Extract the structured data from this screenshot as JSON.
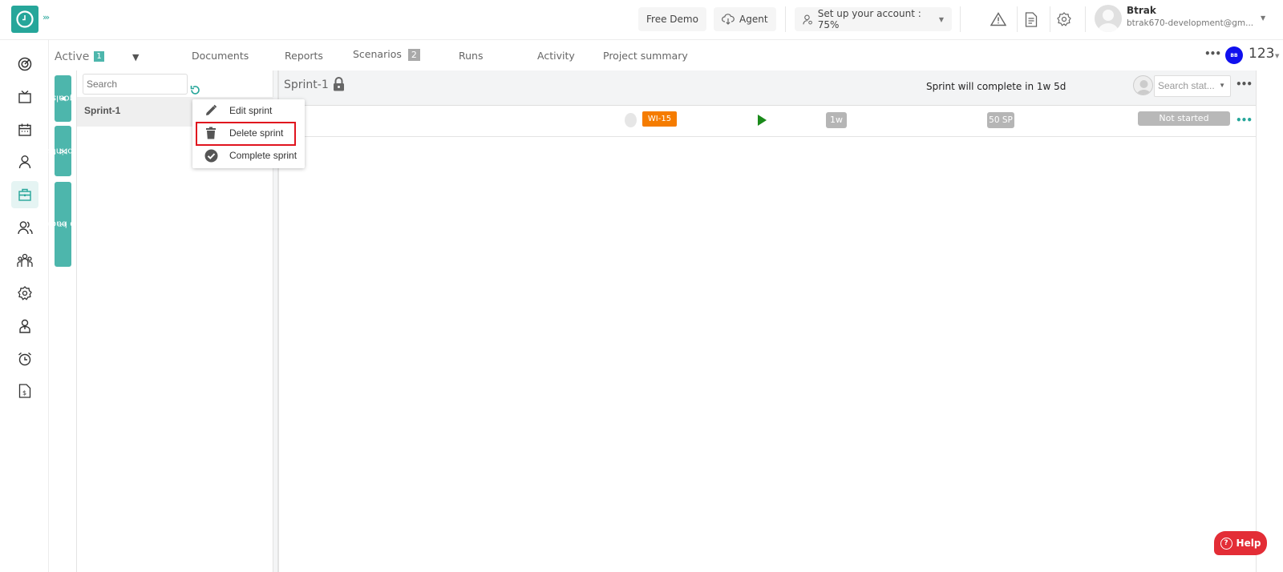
{
  "topbar": {
    "expand_icon": "chevrons-right",
    "free_demo_label": "Free Demo",
    "agent_label": "Agent",
    "setup_label": "Set up your account : 75%",
    "setup_progress_percent": 75,
    "user_name": "Btrak",
    "user_email": "btrak670-development@gm..."
  },
  "left_nav": {
    "items": [
      {
        "icon": "target-icon"
      },
      {
        "icon": "tv-icon"
      },
      {
        "icon": "calendar-icon"
      },
      {
        "icon": "user-icon"
      },
      {
        "icon": "briefcase-icon",
        "active": true
      },
      {
        "icon": "users-icon"
      },
      {
        "icon": "team-icon"
      },
      {
        "icon": "settings-icon"
      },
      {
        "icon": "user-profile-icon"
      },
      {
        "icon": "alarm-icon"
      },
      {
        "icon": "invoice-icon"
      }
    ]
  },
  "tabs": {
    "active_label": "Active",
    "active_count": "1",
    "items": [
      {
        "label": "Documents"
      },
      {
        "label": "Reports"
      },
      {
        "label": "Scenarios",
        "badge": "2"
      },
      {
        "label": "Runs"
      },
      {
        "label": "Activity"
      },
      {
        "label": "Project summary"
      }
    ]
  },
  "project": {
    "avatar_initials": "BB",
    "avatar_color": "#1010ee",
    "name": "123"
  },
  "side_pills": {
    "goals": "goals",
    "sprints": "Sprints",
    "backlog": "Go to backlog"
  },
  "sprint_list": {
    "search_placeholder": "Search",
    "items": [
      {
        "name": "Sprint-1"
      }
    ]
  },
  "context_menu": {
    "items": [
      {
        "label": "Edit sprint",
        "icon": "pencil-icon"
      },
      {
        "label": "Delete sprint",
        "icon": "trash-icon",
        "highlighted": true
      },
      {
        "label": "Complete sprint",
        "icon": "check-circle-icon"
      }
    ]
  },
  "sprint_detail": {
    "title": "Sprint-1",
    "completion_message": "Sprint will complete in 1w 5d",
    "status_search_placeholder": "Search stat...",
    "rows": [
      {
        "work_item_id": "WI-15",
        "estimate": "1w",
        "story_points": "50 SP",
        "status": "Not started"
      }
    ]
  },
  "help": {
    "label": "Help"
  },
  "colors": {
    "brand": "#26a69a",
    "work_item_badge": "#f57c00",
    "highlight_border": "#e0141e",
    "help_button": "#e32d36",
    "play": "#1a8a1a"
  }
}
